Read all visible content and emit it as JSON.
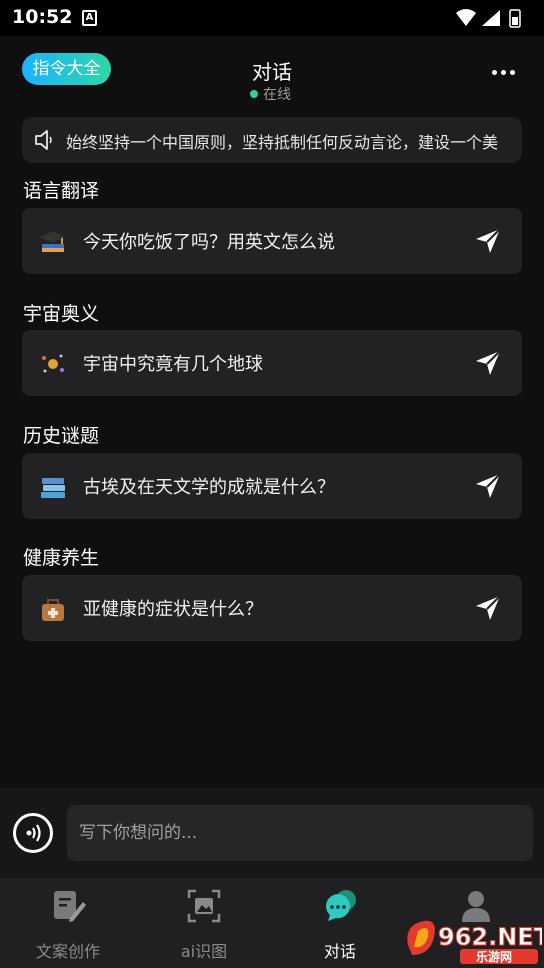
{
  "status_bar": {
    "time": "10:52",
    "app_badge": "A"
  },
  "header": {
    "command_button": "指令大全",
    "title": "对话",
    "status": "在线"
  },
  "notice": {
    "text": "始终坚持一个中国原则，坚持抵制任何反动言论，建设一个美"
  },
  "sections": [
    {
      "title": "语言翻译",
      "prompt": "今天你吃饭了吗？用英文怎么说",
      "icon": "graduation-cap-icon"
    },
    {
      "title": "宇宙奥义",
      "prompt": "宇宙中究竟有几个地球",
      "icon": "galaxy-icon"
    },
    {
      "title": "历史谜题",
      "prompt": "古埃及在天文学的成就是什么？",
      "icon": "books-icon"
    },
    {
      "title": "健康养生",
      "prompt": "亚健康的症状是什么？",
      "icon": "medical-bag-icon"
    }
  ],
  "composer": {
    "placeholder": "写下你想问的..."
  },
  "tabs": [
    {
      "label": "文案创作",
      "icon": "edit-document-icon",
      "active": false
    },
    {
      "label": "ai识图",
      "icon": "image-scan-icon",
      "active": false
    },
    {
      "label": "对话",
      "icon": "chat-bubble-icon",
      "active": true
    },
    {
      "label": "",
      "icon": "user-icon",
      "active": false
    }
  ],
  "watermark": {
    "text": "962.NET",
    "subtext": "乐游网"
  },
  "colors": {
    "accent_gradient_start": "#1bb3ff",
    "accent_gradient_end": "#2fd6a7",
    "online_dot": "#27d98a",
    "active_tab": "#2ec9c0"
  }
}
